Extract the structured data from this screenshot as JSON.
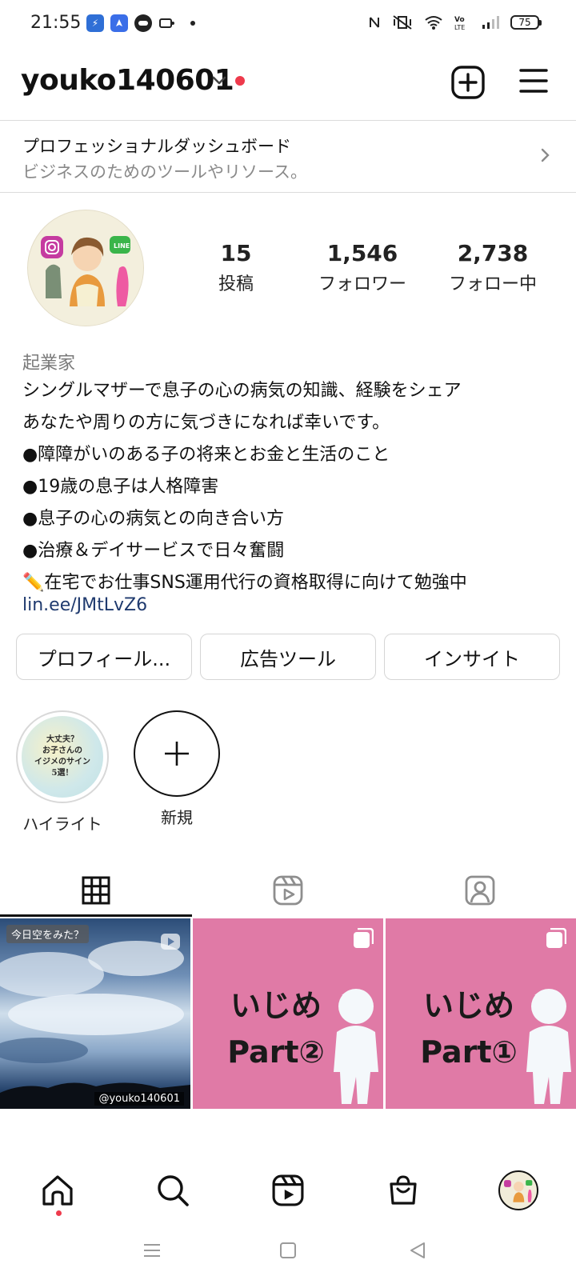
{
  "status_bar": {
    "time": "21:55",
    "battery": "75",
    "apps": [
      "lightning-icon",
      "rocket-icon",
      "line-icon",
      "voicemail-icon"
    ],
    "indicators": [
      "nfc-icon",
      "vibrate-icon",
      "wifi-icon",
      "volte-icon",
      "signal-icon",
      "battery-icon"
    ]
  },
  "header": {
    "username": "youko140601",
    "notification_dot_color": "#ee3a4c"
  },
  "professional_dashboard": {
    "title": "プロフェッショナルダッシュボード",
    "subtitle": "ビジネスのためのツールやリソース。"
  },
  "profile": {
    "stats": [
      {
        "count": "15",
        "label": "投稿"
      },
      {
        "count": "1,546",
        "label": "フォロワー"
      },
      {
        "count": "2,738",
        "label": "フォロー中"
      }
    ],
    "category": "起業家",
    "bio_lines": [
      "シングルマザーで息子の心の病気の知識、経験をシェア",
      "あなたや周りの方に気づきになれば幸いです。",
      "●障障がいのある子の将来とお金と生活のこと",
      "●19歳の息子は人格障害",
      "●息子の心の病気との向き合い方",
      "●治療＆デイサービスで日々奮闘",
      "✏️在宅でお仕事SNS運用代行の資格取得に向けて勉強中"
    ],
    "link": "lin.ee/JMtLvZ6"
  },
  "action_buttons": {
    "edit_profile": "プロフィール...",
    "ad_tools": "広告ツール",
    "insights": "インサイト"
  },
  "highlights": [
    {
      "label": "ハイライト",
      "cover_text": [
        "大丈夫？",
        "お子さんの",
        "イジメのサイン",
        "5選！"
      ]
    },
    {
      "label": "新規"
    }
  ],
  "tabs": [
    "grid-icon",
    "reels-icon",
    "tagged-icon"
  ],
  "posts": [
    {
      "kind": "video",
      "badge": "今日空をみた？",
      "watermark": "@youko140601"
    },
    {
      "kind": "carousel",
      "title_line1": "いじめ",
      "title_line2": "Part②",
      "bg": "#e07aa6"
    },
    {
      "kind": "carousel",
      "title_line1": "いじめ",
      "title_line2": "Part①",
      "bg": "#e07aa6"
    }
  ],
  "bottom_nav": [
    "home-icon",
    "search-icon",
    "reels-icon",
    "shop-icon",
    "profile-avatar"
  ],
  "accent_color": "#ee3a4c"
}
